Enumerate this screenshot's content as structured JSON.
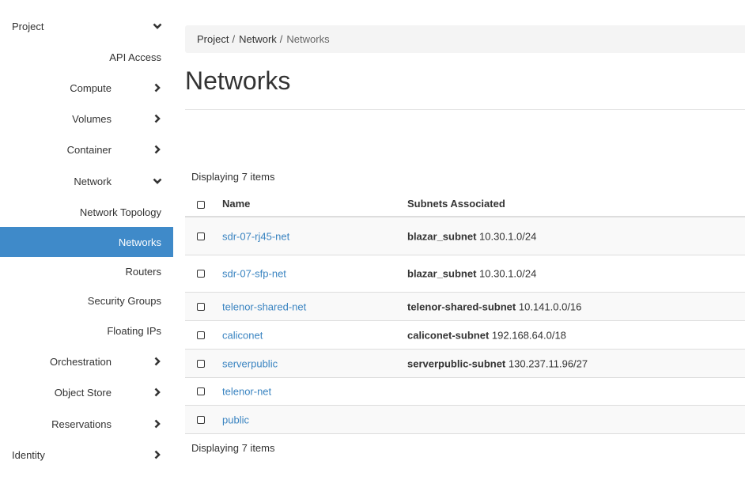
{
  "sidebar": {
    "items": [
      {
        "label": "Project",
        "level": "top",
        "chevron": "down"
      },
      {
        "label": "API Access",
        "level": "leaf",
        "chevron": null
      },
      {
        "label": "Compute",
        "level": "group",
        "chevron": "right"
      },
      {
        "label": "Volumes",
        "level": "group",
        "chevron": "right"
      },
      {
        "label": "Container",
        "level": "group",
        "chevron": "right"
      },
      {
        "label": "Network",
        "level": "group",
        "chevron": "down"
      },
      {
        "label": "Network Topology",
        "level": "leaf",
        "chevron": null
      },
      {
        "label": "Networks",
        "level": "leaf",
        "chevron": null,
        "active": true
      },
      {
        "label": "Routers",
        "level": "leaf",
        "chevron": null
      },
      {
        "label": "Security Groups",
        "level": "leaf",
        "chevron": null
      },
      {
        "label": "Floating IPs",
        "level": "leaf",
        "chevron": null
      },
      {
        "label": "Orchestration",
        "level": "group",
        "chevron": "right"
      },
      {
        "label": "Object Store",
        "level": "group",
        "chevron": "right"
      },
      {
        "label": "Reservations",
        "level": "group",
        "chevron": "right"
      },
      {
        "label": "Identity",
        "level": "top",
        "chevron": "right"
      }
    ],
    "active_color": "#3f8ac9"
  },
  "breadcrumb": {
    "items": [
      "Project",
      "Network",
      "Networks"
    ],
    "separator": "/"
  },
  "page": {
    "title": "Networks"
  },
  "table": {
    "count_top": "Displaying 7 items",
    "count_bottom": "Displaying 7 items",
    "columns": [
      "Name",
      "Subnets Associated"
    ],
    "rows": [
      {
        "name": "sdr-07-rj45-net",
        "subnet_name": "blazar_subnet",
        "subnet_cidr": "10.30.1.0/24"
      },
      {
        "name": "sdr-07-sfp-net",
        "subnet_name": "blazar_subnet",
        "subnet_cidr": "10.30.1.0/24"
      },
      {
        "name": "telenor-shared-net",
        "subnet_name": "telenor-shared-subnet",
        "subnet_cidr": "10.141.0.0/16"
      },
      {
        "name": "caliconet",
        "subnet_name": "caliconet-subnet",
        "subnet_cidr": "192.168.64.0/18"
      },
      {
        "name": "serverpublic",
        "subnet_name": "serverpublic-subnet",
        "subnet_cidr": "130.237.11.96/27"
      },
      {
        "name": "telenor-net",
        "subnet_name": "",
        "subnet_cidr": ""
      },
      {
        "name": "public",
        "subnet_name": "",
        "subnet_cidr": ""
      }
    ],
    "link_color": "#3a84c1"
  }
}
